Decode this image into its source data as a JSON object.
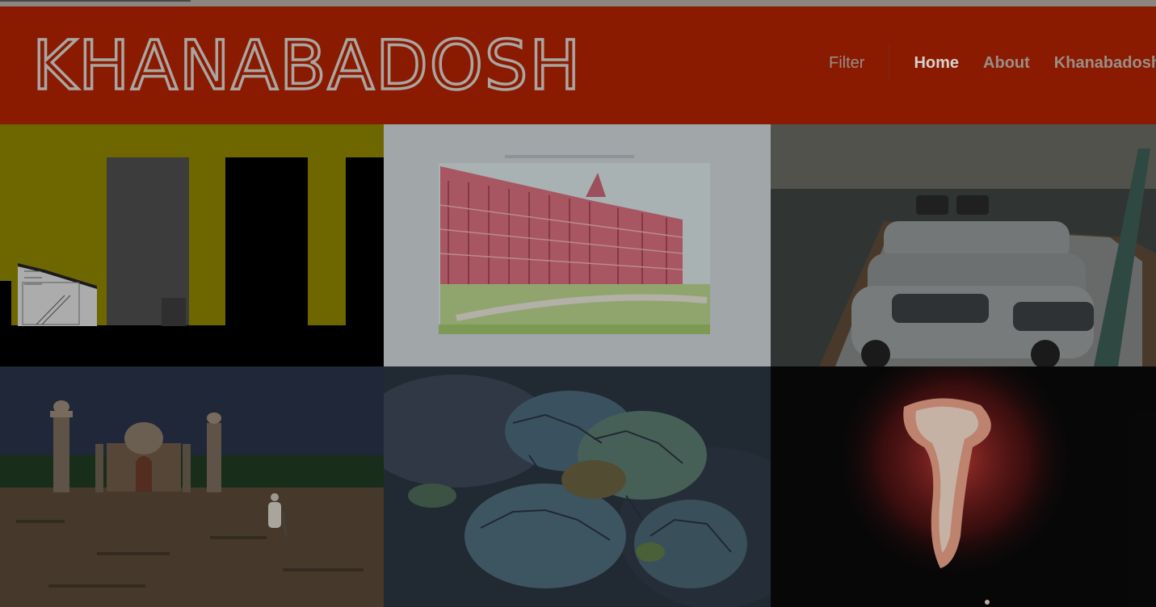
{
  "site": {
    "logo_text": "KHANABADOSH"
  },
  "nav": {
    "filter_label": "Filter",
    "items": [
      {
        "label": "Home",
        "active": true
      },
      {
        "label": "About",
        "active": false
      },
      {
        "label": "Khanabadosh",
        "active": false
      }
    ]
  },
  "colors": {
    "header_bg": "#8a1a00",
    "tile_yellow": "#8e8400",
    "logo_stroke": "#a9a6a1"
  },
  "thumbnails": [
    {
      "name": "architectural-section-drawing"
    },
    {
      "name": "building-watercolor-sketch"
    },
    {
      "name": "cars-on-boat"
    },
    {
      "name": "taj-mahal-replica-field"
    },
    {
      "name": "tortoises"
    },
    {
      "name": "red-light-trail"
    }
  ]
}
